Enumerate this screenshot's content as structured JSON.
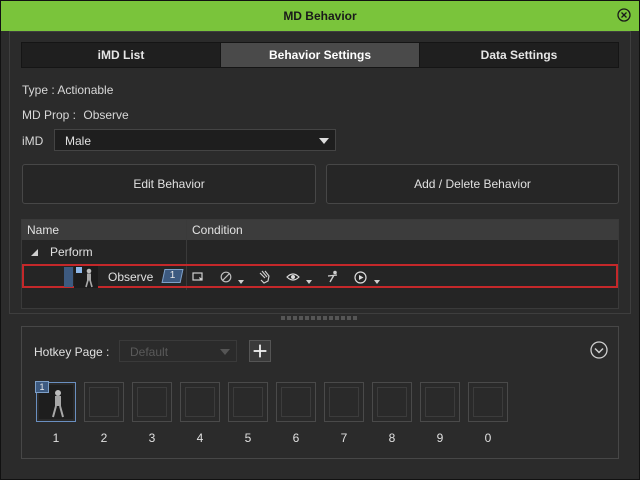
{
  "window": {
    "title": "MD Behavior"
  },
  "tabs": [
    {
      "label": "iMD List"
    },
    {
      "label": "Behavior Settings"
    },
    {
      "label": "Data Settings"
    }
  ],
  "info": {
    "type_label": "Type :",
    "type_value": "Actionable",
    "prop_label": "MD Prop :",
    "prop_value": "Observe",
    "imd_label": "iMD",
    "imd_value": "Male"
  },
  "buttons": {
    "edit": "Edit Behavior",
    "add_delete": "Add / Delete Behavior"
  },
  "table": {
    "columns": [
      "Name",
      "Condition"
    ],
    "group": "Perform",
    "row": {
      "name": "Observe",
      "badge": "1"
    }
  },
  "hotkey": {
    "label": "Hotkey Page :",
    "page_placeholder": "Default",
    "slots": [
      "1",
      "2",
      "3",
      "4",
      "5",
      "6",
      "7",
      "8",
      "9",
      "0"
    ],
    "first_slot_badge": "1"
  },
  "colors": {
    "title_bar": "#7ac43b",
    "highlight_border": "#c4282a",
    "active_tab": "#4a4a4a"
  }
}
